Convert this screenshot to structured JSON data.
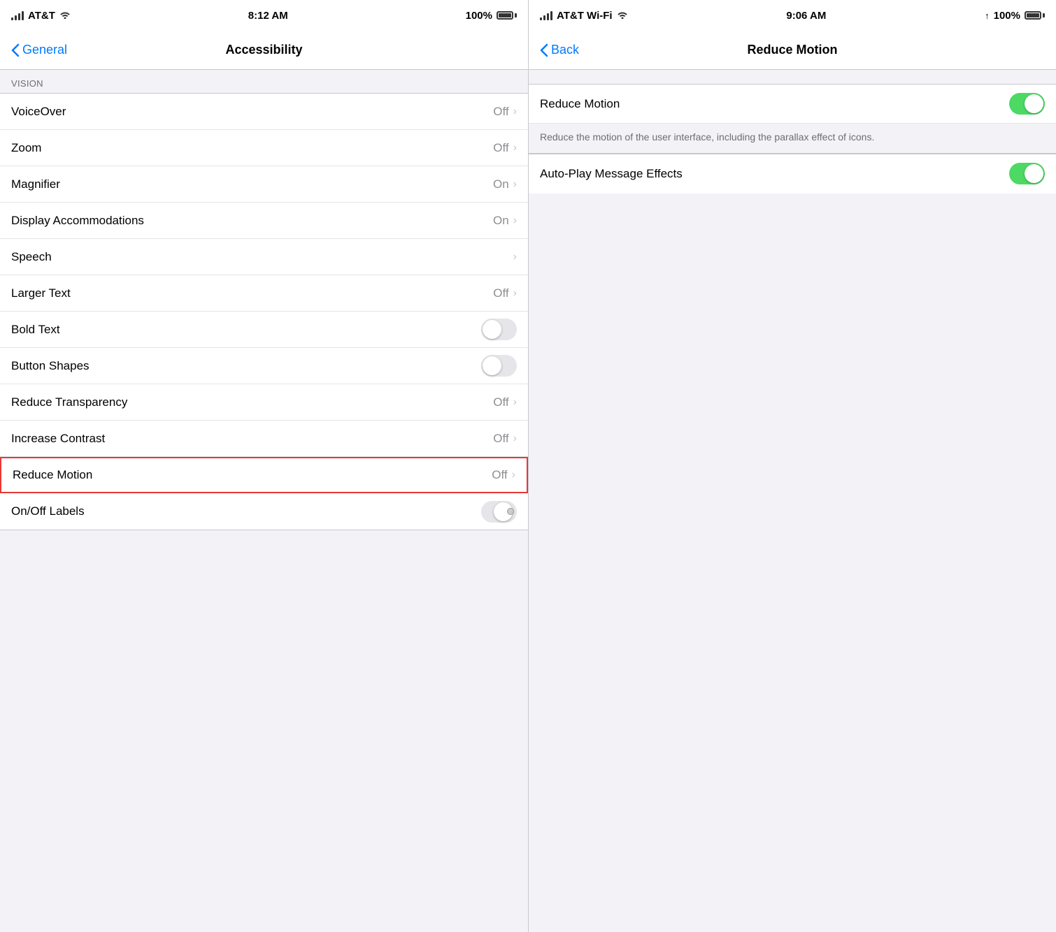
{
  "left": {
    "statusBar": {
      "carrier": "AT&T",
      "time": "8:12 AM",
      "battery": "100%"
    },
    "nav": {
      "backLabel": "General",
      "title": "Accessibility"
    },
    "sections": [
      {
        "header": "VISION",
        "rows": [
          {
            "id": "voiceover",
            "label": "VoiceOver",
            "value": "Off",
            "type": "chevron"
          },
          {
            "id": "zoom",
            "label": "Zoom",
            "value": "Off",
            "type": "chevron"
          },
          {
            "id": "magnifier",
            "label": "Magnifier",
            "value": "On",
            "type": "chevron"
          },
          {
            "id": "display-accommodations",
            "label": "Display Accommodations",
            "value": "On",
            "type": "chevron"
          },
          {
            "id": "speech",
            "label": "Speech",
            "value": "",
            "type": "chevron"
          },
          {
            "id": "larger-text",
            "label": "Larger Text",
            "value": "Off",
            "type": "chevron"
          },
          {
            "id": "bold-text",
            "label": "Bold Text",
            "value": "",
            "type": "toggle",
            "on": false
          },
          {
            "id": "button-shapes",
            "label": "Button Shapes",
            "value": "",
            "type": "toggle",
            "on": false
          },
          {
            "id": "reduce-transparency",
            "label": "Reduce Transparency",
            "value": "Off",
            "type": "chevron"
          },
          {
            "id": "increase-contrast",
            "label": "Increase Contrast",
            "value": "Off",
            "type": "chevron"
          },
          {
            "id": "reduce-motion",
            "label": "Reduce Motion",
            "value": "Off",
            "type": "chevron",
            "highlighted": true
          },
          {
            "id": "on-off-labels",
            "label": "On/Off Labels",
            "value": "",
            "type": "toggle",
            "on": false
          }
        ]
      }
    ]
  },
  "right": {
    "statusBar": {
      "carrier": "AT&T Wi-Fi",
      "time": "9:06 AM",
      "battery": "100%"
    },
    "nav": {
      "backLabel": "Back",
      "title": "Reduce Motion"
    },
    "rows": [
      {
        "id": "reduce-motion-toggle",
        "label": "Reduce Motion",
        "type": "toggle",
        "on": true
      }
    ],
    "description": "Reduce the motion of the user interface, including the parallax effect of icons.",
    "rows2": [
      {
        "id": "auto-play-toggle",
        "label": "Auto-Play Message Effects",
        "type": "toggle",
        "on": true
      }
    ]
  }
}
